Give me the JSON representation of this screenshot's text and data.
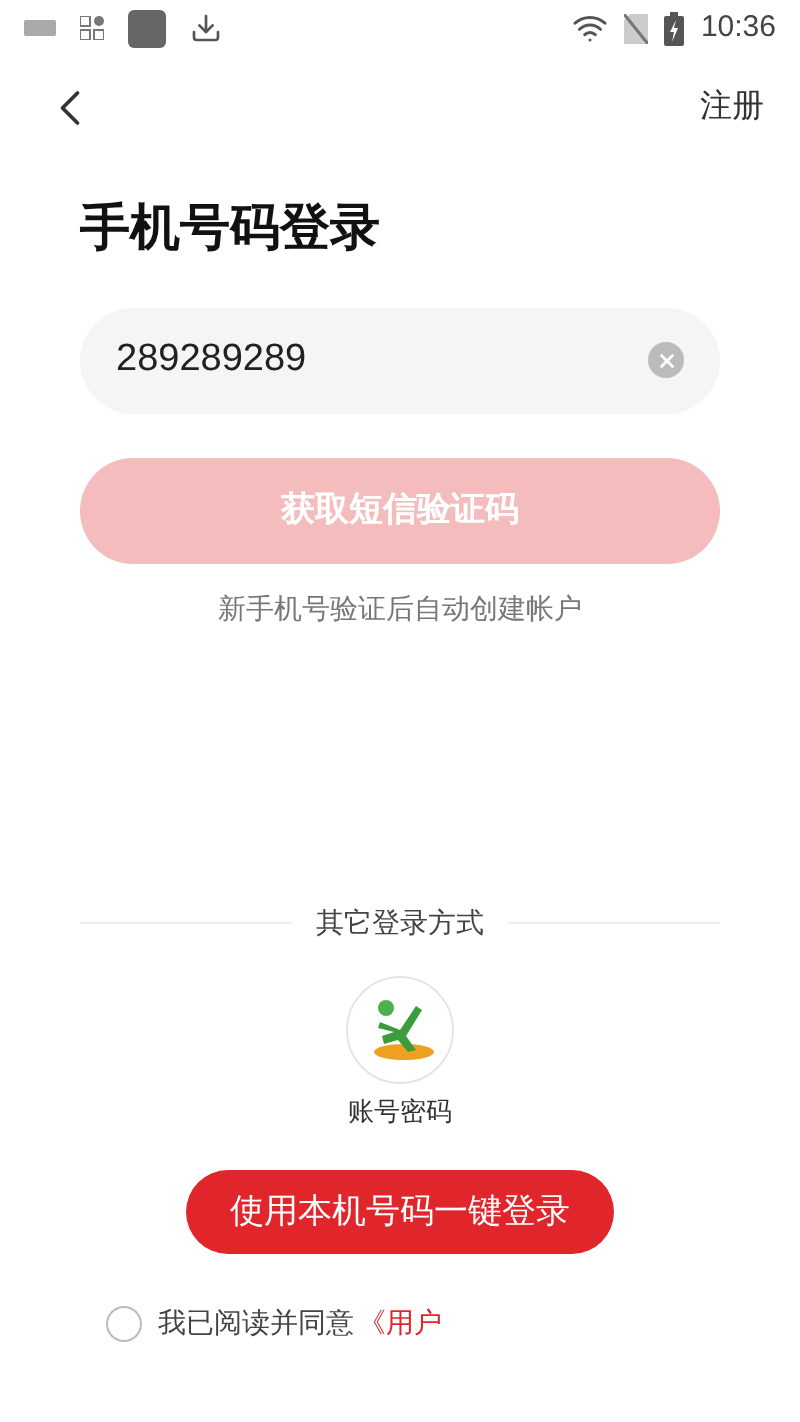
{
  "status_bar": {
    "time": "10:36"
  },
  "nav": {
    "action": "注册"
  },
  "title": "手机号码登录",
  "phone_field": {
    "value": "289289289"
  },
  "sms_button": {
    "label": "获取短信验证码",
    "disabled": true
  },
  "hint": "新手机号验证后自动创建帐户",
  "other_methods": {
    "heading": "其它登录方式",
    "items": [
      {
        "label": "账号密码"
      }
    ]
  },
  "one_click_button": {
    "label": "使用本机号码一键登录"
  },
  "agreement": {
    "checked": false,
    "text": "我已阅读并同意",
    "link": "《用户"
  }
}
